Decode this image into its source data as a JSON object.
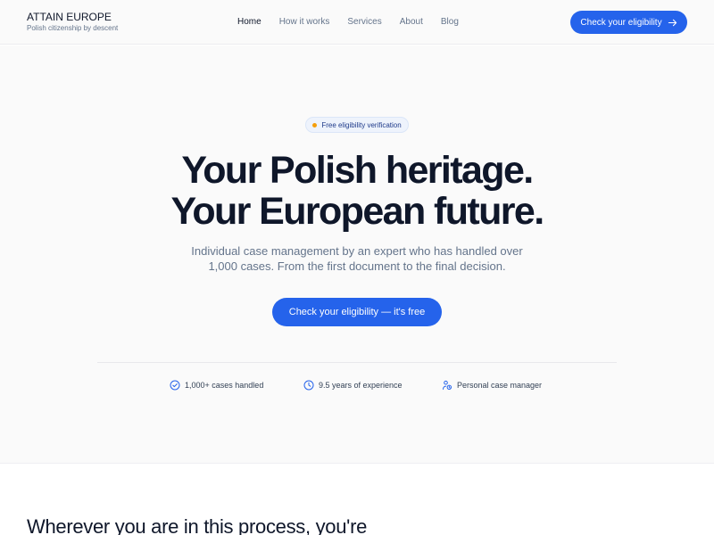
{
  "brand": {
    "name": "ATTAIN EUROPE",
    "tagline": "Polish citizenship by descent"
  },
  "nav": {
    "items": [
      {
        "label": "Home",
        "active": true
      },
      {
        "label": "How it works",
        "active": false
      },
      {
        "label": "Services",
        "active": false
      },
      {
        "label": "About",
        "active": false
      },
      {
        "label": "Blog",
        "active": false
      }
    ]
  },
  "header_cta": {
    "label": "Check your eligibility",
    "icon": "arrow-right-icon"
  },
  "hero": {
    "badge": "Free eligibility verification",
    "headline_line1": "Your Polish heritage.",
    "headline_line2": "Your European future.",
    "subtext_line1": "Individual case management by an expert who has handled over",
    "subtext_line2": "1,000 cases. From the first document to the final decision.",
    "cta": "Check your eligibility — it's free"
  },
  "stats": [
    {
      "label": "1,000+ cases handled",
      "icon": "check-circle-icon"
    },
    {
      "label": "9.5 years of experience",
      "icon": "clock-icon"
    },
    {
      "label": "Personal case manager",
      "icon": "person-icon"
    }
  ],
  "next_section": {
    "title": "Wherever you are in this process, you're"
  },
  "colors": {
    "accent": "#2563eb",
    "badge_dot": "#f59e0b",
    "text_dark": "#0f172a",
    "text_muted": "#64748b"
  }
}
